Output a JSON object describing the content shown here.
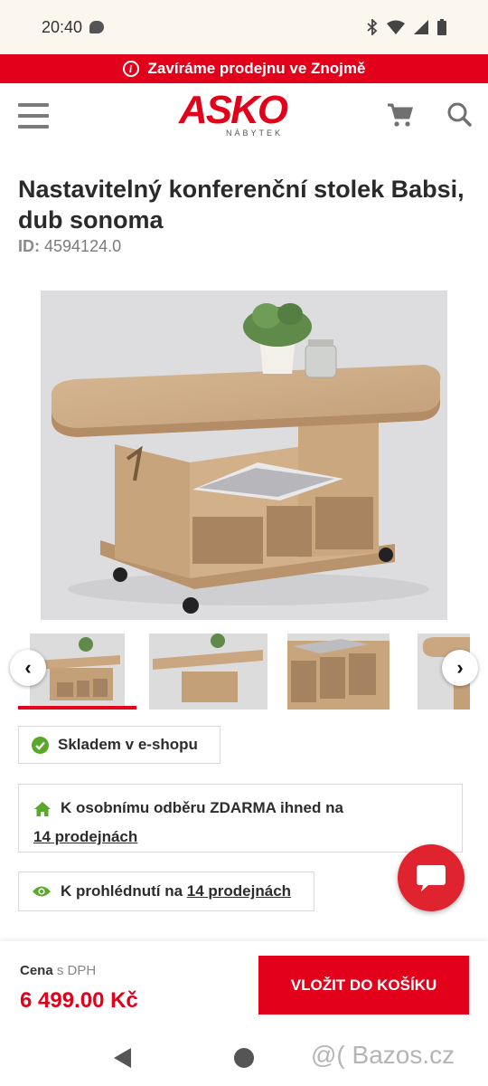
{
  "status_bar": {
    "time": "20:40"
  },
  "announcement": {
    "info_glyph": "i",
    "text": "Zavíráme prodejnu ve Znojmě"
  },
  "header": {
    "logo": "ASKO",
    "logo_sub": "NÁBYTEK",
    "menu_icon": "hamburger-icon",
    "cart_icon": "cart-icon",
    "search_icon": "search-icon"
  },
  "product": {
    "title": "Nastavitelný konferenční stolek Babsi, dub sonoma",
    "id_label": "ID:",
    "id_value": "4594124.0"
  },
  "gallery": {
    "prev_label": "‹",
    "next_label": "›",
    "thumb_count": 4
  },
  "availability": {
    "stock": "Skladem v e-shopu",
    "pickup_text": "K osobnímu odběru ZDARMA ihned na",
    "pickup_link": "14 prodejnách",
    "view_text": "K prohlédnutí na",
    "view_link": "14 prodejnách"
  },
  "price_bar": {
    "label": "Cena",
    "label_suffix": "s DPH",
    "price": "6 499.00 Kč",
    "add_button": "VLOŽIT DO KOŠÍKU"
  },
  "colors": {
    "brand_red": "#e2001a",
    "check_green": "#5aa82a"
  },
  "watermark": "@( Bazos.cz"
}
